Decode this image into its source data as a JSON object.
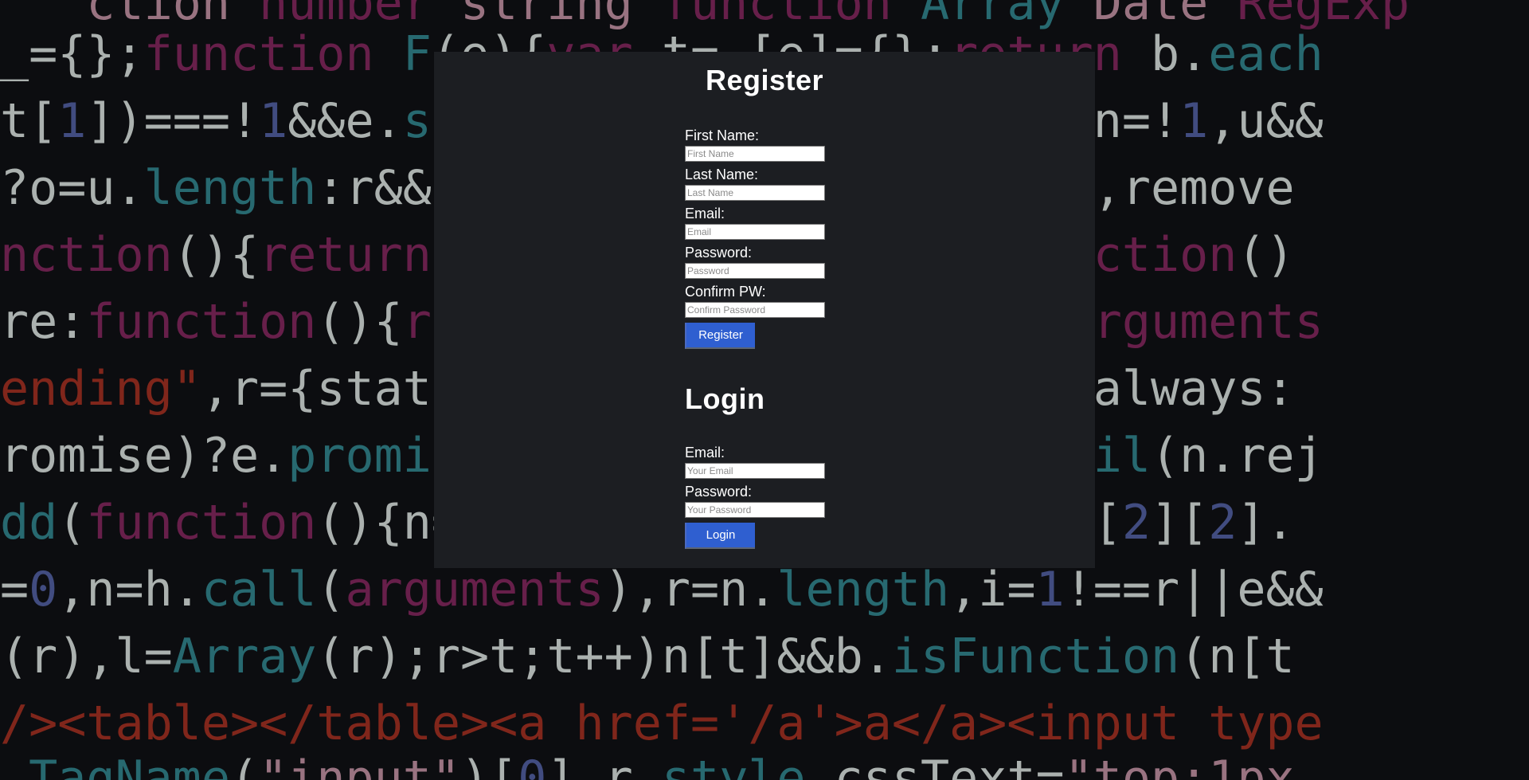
{
  "register": {
    "title": "Register",
    "fields": [
      {
        "label": "First Name:",
        "placeholder": "First Name"
      },
      {
        "label": "Last Name:",
        "placeholder": "Last Name"
      },
      {
        "label": "Email:",
        "placeholder": "Email"
      },
      {
        "label": "Password:",
        "placeholder": "Password"
      },
      {
        "label": "Confirm PW:",
        "placeholder": "Confirm Password"
      }
    ],
    "button_label": "Register"
  },
  "login": {
    "title": "Login",
    "fields": [
      {
        "label": "Email:",
        "placeholder": "Your Email"
      },
      {
        "label": "Password:",
        "placeholder": "Your Password"
      }
    ],
    "button_label": "Login"
  },
  "colors": {
    "panel": "#1c1e22",
    "button": "#2f5fd0"
  }
}
